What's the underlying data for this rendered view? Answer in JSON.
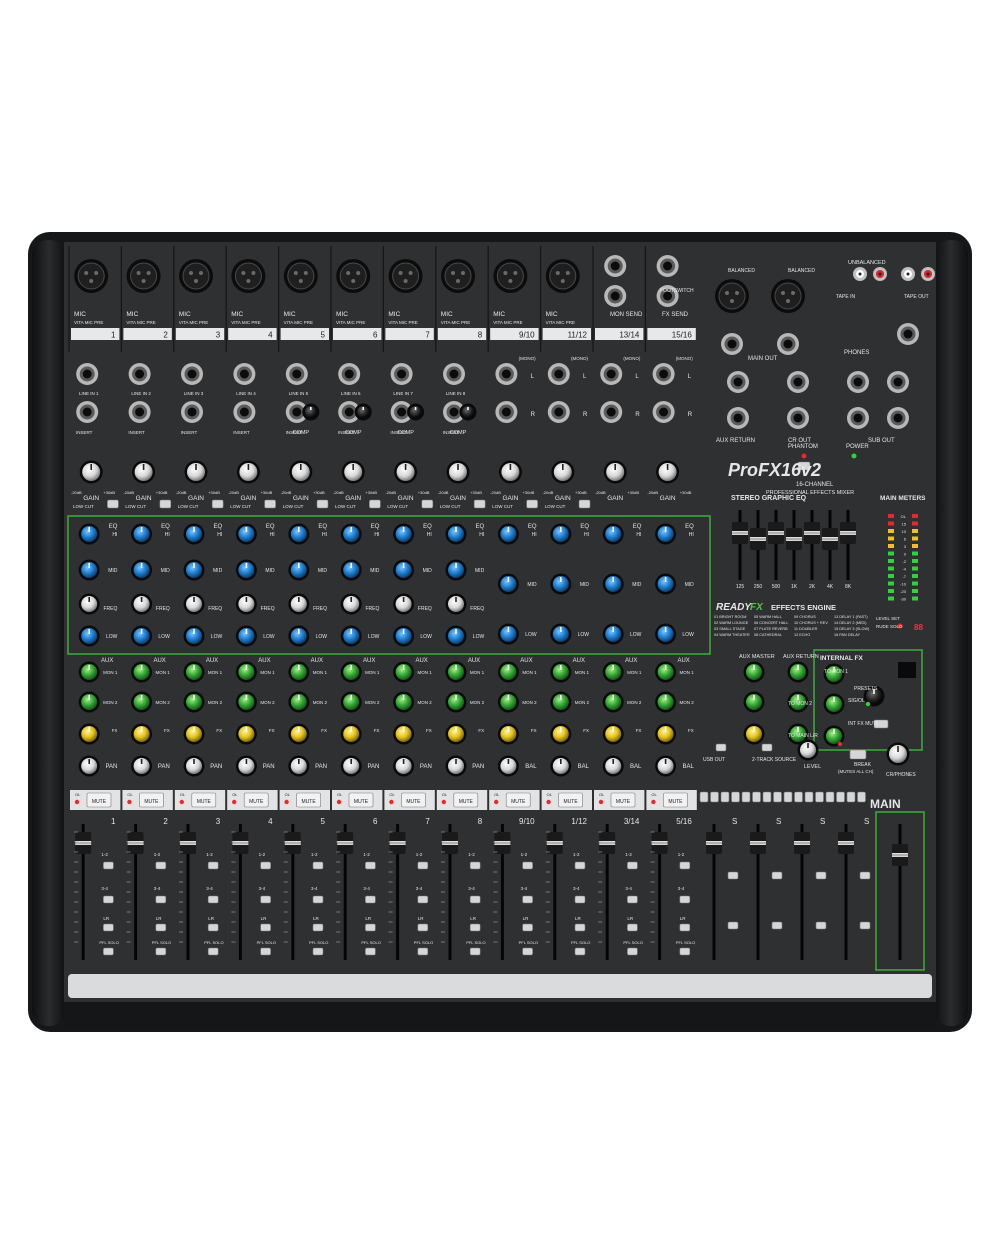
{
  "product": {
    "brand_name": "ProFX16v2",
    "subtitle_line1": "16-CHANNEL",
    "subtitle_line2": "PROFESSIONAL EFFECTS MIXER"
  },
  "mono_channels": [
    "1",
    "2",
    "3",
    "4",
    "5",
    "6",
    "7",
    "8"
  ],
  "stereo_channels": [
    "9/10",
    "11/12",
    "13/14",
    "15/16"
  ],
  "fader_labels": [
    "1",
    "2",
    "3",
    "4",
    "5",
    "6",
    "7",
    "8",
    "9/10",
    "1/12",
    "3/14",
    "5/16"
  ],
  "subgroup_labels": [
    "S",
    "S",
    "S",
    "S"
  ],
  "labels": {
    "mic": "MIC",
    "vita": "VITA MIC PRE",
    "line_in_prefix": "LINE IN ",
    "insert": "INSERT",
    "comp": "COMP",
    "gain": "GAIN",
    "gain_min": "-20dB",
    "gain_max": "+30dB",
    "low_cut": "LOW CUT",
    "low_cut_freq": "100Hz",
    "eq": "EQ",
    "hi": "HI",
    "hi_freq": "12kHz",
    "mid": "MID",
    "freq": "FREQ",
    "low": "LOW",
    "low_freq": "80Hz",
    "aux": "AUX",
    "mon1": "MON 1",
    "mon2": "MON 2",
    "fx": "FX",
    "pan": "PAN",
    "bal": "BAL",
    "mute": "MUTE",
    "ol": "OL",
    "pfl_solo": "PFL SOLO",
    "lr": "LR",
    "bus12": "1-2",
    "bus34": "3-4",
    "mono": "(MONO)",
    "l": "L",
    "r": "R",
    "bal_unbal": "BAL/ UNBAL",
    "mon_send": "MON SEND",
    "fx_send": "FX SEND",
    "footswitch": "FOOTSWITCH",
    "balanced": "BALANCED",
    "main_out": "MAIN OUT",
    "unbalanced": "UNBALANCED",
    "tape_in": "TAPE IN",
    "tape_out": "TAPE OUT",
    "phones": "PHONES",
    "aux_return": "AUX RETURN",
    "cr_out": "CR OUT",
    "sub_out": "SUB OUT",
    "phantom": "PHANTOM",
    "power": "POWER",
    "stereo_geq": "STEREO GRAPHIC EQ",
    "geq_bands": [
      "125",
      "250",
      "500",
      "1K",
      "2K",
      "4K",
      "8K"
    ],
    "main_meters": "MAIN METERS",
    "meter_scale": [
      "OL",
      "15",
      "10",
      "6",
      "3",
      "0",
      "-2",
      "-4",
      "-7",
      "-10",
      "-20",
      "-30"
    ],
    "ready": "READY",
    "fx_word": "FX",
    "effects_engine": "EFFECTS ENGINE",
    "fx_presets_col1": [
      "01 BRIGHT ROOM",
      "02 WARM LOUNGE",
      "03 SMALL STAGE",
      "04 WARM THEATER"
    ],
    "fx_presets_col2": [
      "05 WARM HALL",
      "06 CONCERT HALL",
      "07 PLATE REVERB",
      "08 CATHEDRAL"
    ],
    "fx_presets_col3": [
      "09 CHORUS",
      "10 CHORUS + REV",
      "11 DOUBLER",
      "12 ECHO"
    ],
    "fx_presets_col4": [
      "13 DELAY 1 (FAST)",
      "14 DELAY 2 (MED)",
      "15 DELAY 3 (SLOW)",
      "16 PAN DELAY"
    ],
    "aux_master": "AUX MASTER",
    "internal_fx": "INTERNAL FX",
    "to_mon1": "TO MON 1",
    "to_mon2": "TO MON 2",
    "to_main_lr": "TO MAIN L/R",
    "presets": "PRESETS",
    "sig_ol": "SIG/OL",
    "int_fx_mute": "INT FX MUTE",
    "preset_display": "88",
    "usb_out": "USB OUT",
    "two_track_source": "2-TRACK SOURCE",
    "level": "LEVEL",
    "break": "BREAK",
    "mutes_all_ch": "(MUTES ALL CH)",
    "cr_phones": "CR/PHONES",
    "main": "MAIN",
    "rude_solo": "RUDE SOLO",
    "level_set": "LEVEL SET"
  },
  "colors": {
    "panel": "#2e3032",
    "chassis": "#1a1b1c",
    "knob_eq": "#1e7fd0",
    "knob_aux": "#35a834",
    "knob_fx": "#e5c31c",
    "green_outline": "#3fae3c",
    "led_red": "#e8282a",
    "led_green": "#2fd13c"
  }
}
